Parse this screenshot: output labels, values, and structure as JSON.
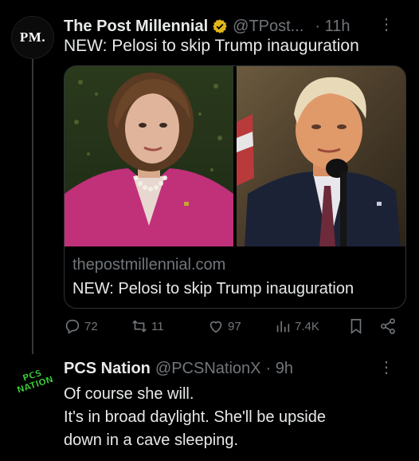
{
  "post": {
    "avatar_text": "PM.",
    "author_name": "The Post Millennial",
    "handle": "@TPost...",
    "time": "· 11h",
    "more": "⋮",
    "text": "NEW: Pelosi to skip Trump inauguration",
    "card": {
      "domain": "thepostmillennial.com",
      "title": "NEW: Pelosi to skip Trump inauguration"
    },
    "metrics": {
      "replies": "72",
      "reposts": "11",
      "likes": "97",
      "views": "7.4K"
    }
  },
  "reply": {
    "avatar_text_1": "PCS",
    "avatar_text_2": "NATION",
    "author_name": "PCS Nation",
    "handle": "@PCSNationX",
    "time": "· 9h",
    "more": "⋮",
    "lines": [
      "Of course she will.",
      "It's in broad daylight. She'll be upside",
      "down in a cave sleeping."
    ]
  },
  "colors": {
    "background": "#000000",
    "text": "#e7e9ea",
    "muted": "#71767b",
    "verified_gold": "#e2b719",
    "pcs_green": "#3be03b"
  }
}
